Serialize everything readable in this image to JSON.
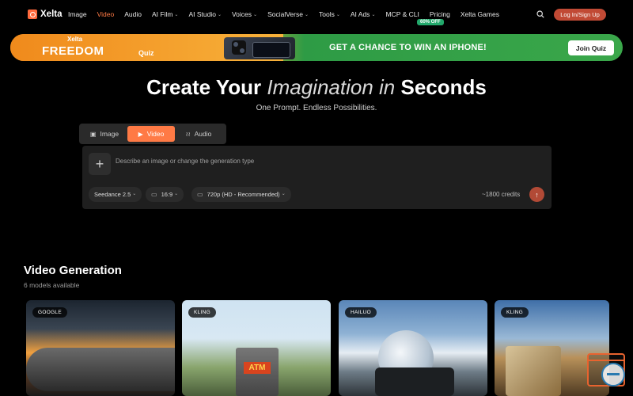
{
  "nav": {
    "brand": "Xelta",
    "items": [
      {
        "label": "Image",
        "chev": ""
      },
      {
        "label": "Video",
        "chev": ""
      },
      {
        "label": "Audio",
        "chev": ""
      },
      {
        "label": "AI Film",
        "chev": "⌄"
      },
      {
        "label": "AI Studio",
        "chev": "⌄"
      },
      {
        "label": "Voices",
        "chev": "⌄"
      },
      {
        "label": "SocialVerse",
        "chev": "⌄"
      },
      {
        "label": "Tools",
        "chev": "⌄"
      },
      {
        "label": "AI Ads",
        "chev": "⌄"
      },
      {
        "label": "MCP & CLI",
        "chev": ""
      },
      {
        "label": "Pricing",
        "chev": ""
      },
      {
        "label": "Xelta Games",
        "chev": ""
      }
    ],
    "pricing_badge": "60% OFF",
    "login_label": "Log In/Sign Up"
  },
  "banner": {
    "brand": "Xelta",
    "freedom": "FREEDOM",
    "quiz": "Quiz",
    "cta": "GET A CHANCE TO WIN AN IPHONE!",
    "button": "Join Quiz"
  },
  "hero": {
    "title_start": "Create Your",
    "title_italic": "Imagination in",
    "title_end": "Seconds",
    "subtitle": "One Prompt. Endless Possibilities."
  },
  "tabs": [
    {
      "label": "Image",
      "icon": "image-icon"
    },
    {
      "label": "Video",
      "icon": "video-icon"
    },
    {
      "label": "Audio",
      "icon": "audio-icon"
    }
  ],
  "prompt": {
    "placeholder": "Describe an image or change the generation type",
    "model": "Seedance 2.5",
    "ratio": "16:9",
    "resolution": "720p (HD - Recommended)",
    "credits": "~1800 credits"
  },
  "section": {
    "title": "Video Generation",
    "subtitle": "6 models available"
  },
  "cards": [
    {
      "badge": "GOOGLE"
    },
    {
      "badge": "KLING",
      "sign": "ATM"
    },
    {
      "badge": "HAILUO"
    },
    {
      "badge": "KLING"
    }
  ]
}
